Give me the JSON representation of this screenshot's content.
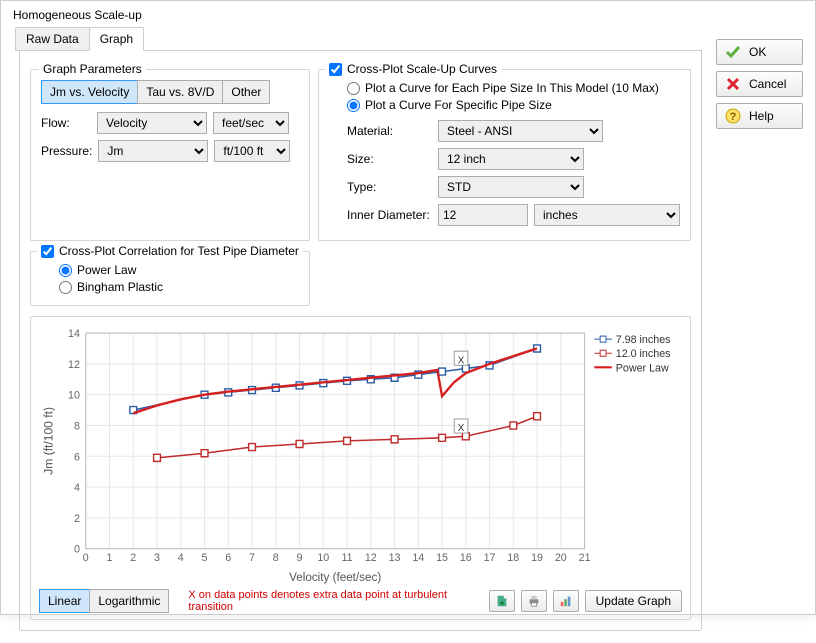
{
  "window": {
    "title": "Homogeneous Scale-up"
  },
  "tabs": {
    "raw": "Raw Data",
    "graph": "Graph"
  },
  "graphParams": {
    "legend": "Graph Parameters",
    "modeA": "Jm vs. Velocity",
    "modeB": "Tau vs. 8V/D",
    "modeC": "Other",
    "flowLabel": "Flow:",
    "flowValue": "Velocity",
    "flowUnit": "feet/sec",
    "pressLabel": "Pressure:",
    "pressValue": "Jm",
    "pressUnit": "ft/100 ft"
  },
  "crossCorr": {
    "label": "Cross-Plot Correlation for Test Pipe Diameter",
    "power": "Power Law",
    "bingham": "Bingham Plastic"
  },
  "scaleUp": {
    "label": "Cross-Plot Scale-Up Curves",
    "optA": "Plot a Curve for Each Pipe Size In This Model (10 Max)",
    "optB": "Plot a Curve For Specific Pipe Size",
    "matLabel": "Material:",
    "matValue": "Steel - ANSI",
    "sizeLabel": "Size:",
    "sizeValue": "12 inch",
    "typeLabel": "Type:",
    "typeValue": "STD",
    "idLabel": "Inner Diameter:",
    "idValue": "12",
    "idUnit": "inches"
  },
  "buttons": {
    "ok": "OK",
    "cancel": "Cancel",
    "help": "Help",
    "linear": "Linear",
    "log": "Logarithmic",
    "update": "Update Graph"
  },
  "footnote": "X on data points denotes extra data point at turbulent transition",
  "chart_data": {
    "type": "line",
    "xlabel": "Velocity (feet/sec)",
    "ylabel": "Jm (ft/100 ft)",
    "xlim": [
      0,
      21
    ],
    "ylim": [
      0,
      14
    ],
    "xticks": [
      0,
      1,
      2,
      3,
      4,
      5,
      6,
      7,
      8,
      9,
      10,
      11,
      12,
      13,
      14,
      15,
      16,
      17,
      18,
      19,
      20,
      21
    ],
    "yticks": [
      0,
      2,
      4,
      6,
      8,
      10,
      12,
      14
    ],
    "legend": [
      "7.98 inches",
      "12.0 inches",
      "Power Law"
    ],
    "annotations": [
      {
        "x": 15.8,
        "y": 12.3,
        "label": "X"
      },
      {
        "x": 15.8,
        "y": 7.9,
        "label": "X"
      }
    ],
    "series": [
      {
        "name": "7.98 inches",
        "marker": "square",
        "color": "#2a5ca8",
        "x": [
          2,
          5,
          6,
          7,
          8,
          9,
          10,
          11,
          12,
          13,
          14,
          15,
          16,
          17,
          19
        ],
        "y": [
          9.0,
          10.0,
          10.15,
          10.3,
          10.45,
          10.6,
          10.75,
          10.9,
          11.0,
          11.1,
          11.3,
          11.5,
          11.7,
          11.9,
          13.0
        ]
      },
      {
        "name": "12.0 inches",
        "marker": "square",
        "color": "#c02b2b",
        "x": [
          3,
          5,
          7,
          9,
          11,
          13,
          15,
          16,
          18,
          19
        ],
        "y": [
          5.9,
          6.2,
          6.6,
          6.8,
          7.0,
          7.1,
          7.2,
          7.3,
          8.0,
          8.6
        ]
      },
      {
        "name": "Power Law",
        "marker": "none",
        "color": "#d61f1f",
        "x": [
          2,
          3,
          4,
          5,
          6,
          7,
          8,
          9,
          10,
          11,
          12,
          13,
          14,
          14.8,
          15.0,
          15.5,
          16,
          17,
          18,
          19
        ],
        "y": [
          8.8,
          9.3,
          9.7,
          10.0,
          10.2,
          10.35,
          10.5,
          10.65,
          10.8,
          10.95,
          11.1,
          11.25,
          11.4,
          11.6,
          9.9,
          10.8,
          11.4,
          12.0,
          12.5,
          13.0
        ]
      }
    ]
  }
}
